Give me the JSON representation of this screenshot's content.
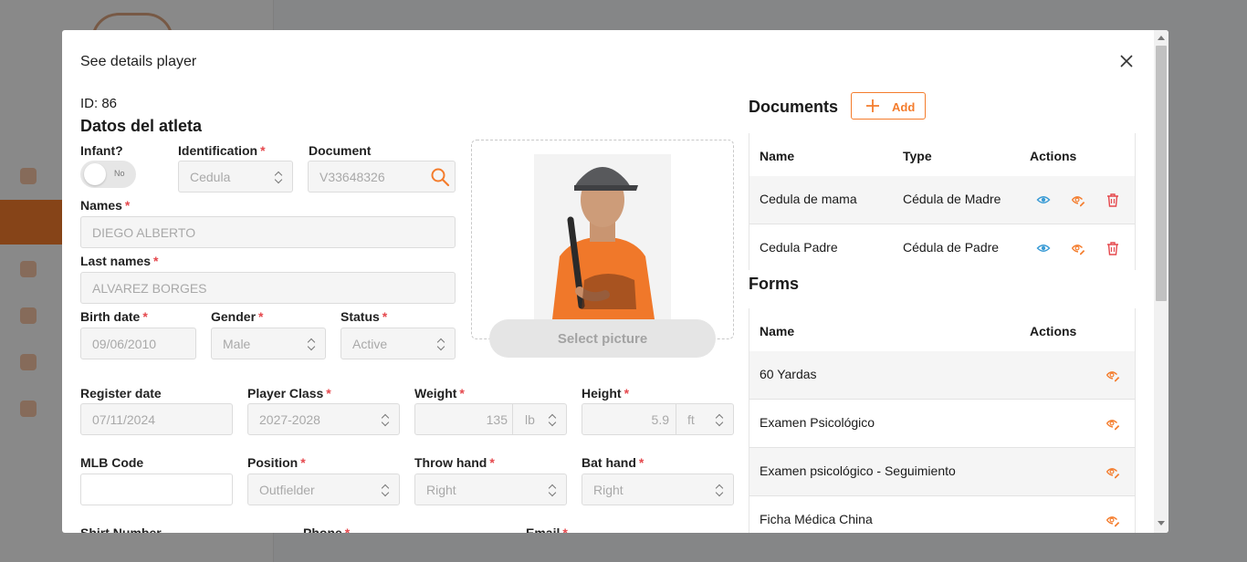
{
  "modal": {
    "title": "See details player"
  },
  "player": {
    "id_text": "ID: 86",
    "section_title": "Datos del atleta",
    "photo_button": "Select picture",
    "toggle_text": "No"
  },
  "labels": {
    "infant": "Infant?",
    "identification": "Identification",
    "document": "Document",
    "names": "Names",
    "last_names": "Last names",
    "birth_date": "Birth date",
    "gender": "Gender",
    "status": "Status",
    "register_date": "Register date",
    "player_class": "Player Class",
    "weight": "Weight",
    "height": "Height",
    "mlb_code": "MLB Code",
    "position": "Position",
    "throw_hand": "Throw hand",
    "bat_hand": "Bat hand",
    "shirt_number": "Shirt Number",
    "phone": "Phone",
    "email": "Email",
    "required_mark": "*"
  },
  "values": {
    "identification": "Cedula",
    "document": "V33648326",
    "names": "DIEGO ALBERTO",
    "last_names": "ALVAREZ BORGES",
    "birth_date": "09/06/2010",
    "gender": "Male",
    "status": "Active",
    "register_date": "07/11/2024",
    "player_class": "2027-2028",
    "weight": "135",
    "weight_unit": "lb",
    "height": "5.9",
    "height_unit": "ft",
    "mlb_code": "",
    "position": "Outfielder",
    "throw_hand": "Right",
    "bat_hand": "Right"
  },
  "documents": {
    "title": "Documents",
    "add_label": "Add",
    "columns": [
      "Name",
      "Type",
      "Actions"
    ],
    "rows": [
      {
        "name": "Cedula de mama",
        "type": "Cédula de Madre"
      },
      {
        "name": "Cedula Padre",
        "type": "Cédula de Padre"
      }
    ]
  },
  "forms": {
    "title": "Forms",
    "columns": [
      "Name",
      "Actions"
    ],
    "rows": [
      {
        "name": "60 Yardas"
      },
      {
        "name": "Examen Psicológico"
      },
      {
        "name": "Examen psicológico - Seguimiento"
      },
      {
        "name": "Ficha Médica China"
      }
    ]
  },
  "colors": {
    "accent": "#f47c2c",
    "view_icon": "#3a9bd5",
    "delete_icon": "#e5484d"
  },
  "icons": [
    "close-icon",
    "search-icon",
    "plus-icon",
    "eye-icon",
    "eye-edit-icon",
    "trash-icon",
    "chevron-updown-icon"
  ]
}
